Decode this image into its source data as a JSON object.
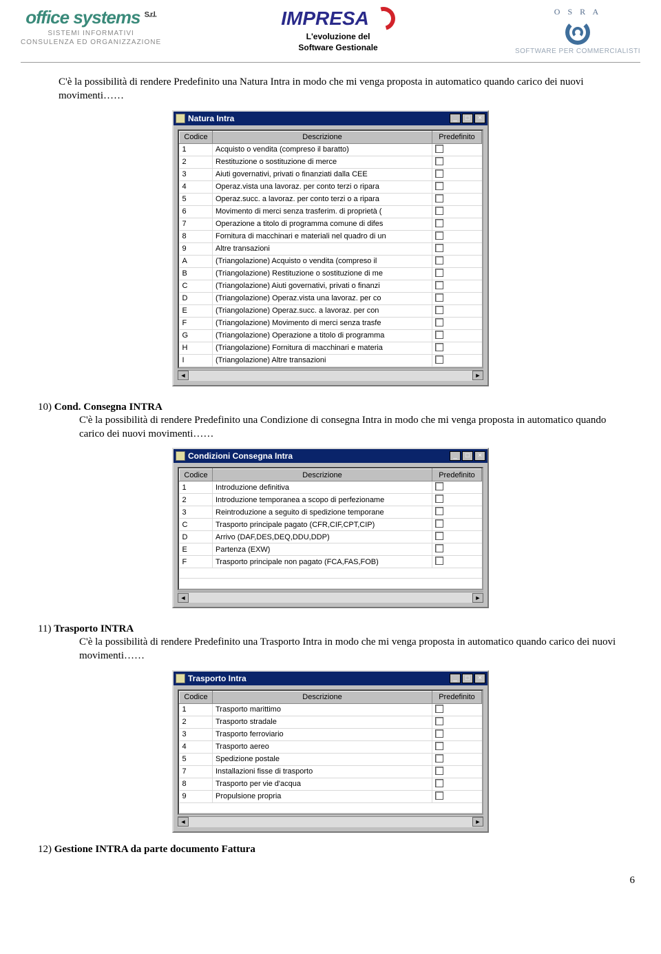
{
  "header": {
    "left": {
      "brand": "office systems",
      "srl": "S.r.l.",
      "sub1": "SISTEMI INFORMATIVI",
      "sub2": "CONSULENZA ED ORGANIZZAZIONE"
    },
    "center": {
      "brand": "IMPRESA",
      "tag_line1": "L'evoluzione del",
      "tag_line2": "Software Gestionale"
    },
    "right": {
      "osra": "O S R A",
      "commerc": "SOFTWARE PER COMMERCIALISTI"
    }
  },
  "intro_para": "C'è  la possibilità di rendere Predefinito una Natura Intra in modo che mi venga proposta in automatico quando carico dei nuovi movimenti……",
  "win1": {
    "title": "Natura Intra",
    "min": "_",
    "max": "□",
    "close": "×",
    "cols": {
      "code": "Codice",
      "desc": "Descrizione",
      "pred": "Predefinito"
    },
    "rows": [
      {
        "c": "1",
        "d": "Acquisto o vendita (compreso il baratto)"
      },
      {
        "c": "2",
        "d": "Restituzione o sostituzione di merce"
      },
      {
        "c": "3",
        "d": "Aiuti governativi, privati o finanziati dalla CEE"
      },
      {
        "c": "4",
        "d": "Operaz.vista una lavoraz. per conto terzi o ripara"
      },
      {
        "c": "5",
        "d": "Operaz.succ. a lavoraz. per conto terzi o a ripara"
      },
      {
        "c": "6",
        "d": "Movimento di merci senza trasferim. di proprietà ("
      },
      {
        "c": "7",
        "d": "Operazione a titolo di programma comune di difes"
      },
      {
        "c": "8",
        "d": "Fornitura di macchinari e materiali nel quadro di un"
      },
      {
        "c": "9",
        "d": "Altre transazioni"
      },
      {
        "c": "A",
        "d": "(Triangolazione) Acquisto o vendita (compreso il"
      },
      {
        "c": "B",
        "d": "(Triangolazione) Restituzione o sostituzione di me"
      },
      {
        "c": "C",
        "d": "(Triangolazione) Aiuti governativi, privati o finanzi"
      },
      {
        "c": "D",
        "d": "(Triangolazione) Operaz.vista una lavoraz. per co"
      },
      {
        "c": "E",
        "d": "(Triangolazione) Operaz.succ. a lavoraz. per con"
      },
      {
        "c": "F",
        "d": "(Triangolazione) Movimento di merci senza trasfe"
      },
      {
        "c": "G",
        "d": "(Triangolazione) Operazione a titolo di programma"
      },
      {
        "c": "H",
        "d": "(Triangolazione) Fornitura di macchinari e materia"
      },
      {
        "c": "I",
        "d": "(Triangolazione) Altre transazioni"
      }
    ],
    "scroll_left": "◄",
    "scroll_right": "►"
  },
  "section10": {
    "num": "10)",
    "title": "Cond. Consegna INTRA",
    "para": "C'è  la possibilità di rendere Predefinito una Condizione di consegna Intra in modo che mi venga proposta in automatico quando carico dei nuovi movimenti……"
  },
  "win2": {
    "title": "Condizioni Consegna Intra",
    "min": "_",
    "max": "□",
    "close": "×",
    "cols": {
      "code": "Codice",
      "desc": "Descrizione",
      "pred": "Predefinito"
    },
    "rows": [
      {
        "c": "1",
        "d": "Introduzione definitiva"
      },
      {
        "c": "2",
        "d": "Introduzione temporanea a scopo di perfezioname"
      },
      {
        "c": "3",
        "d": "Reintroduzione a seguito di spedizione temporane"
      },
      {
        "c": "C",
        "d": "Trasporto principale pagato (CFR,CIF,CPT,CIP)"
      },
      {
        "c": "D",
        "d": "Arrivo (DAF,DES,DEQ,DDU,DDP)"
      },
      {
        "c": "E",
        "d": "Partenza (EXW)"
      },
      {
        "c": "F",
        "d": "Trasporto principale non pagato (FCA,FAS,FOB)"
      }
    ],
    "scroll_left": "◄",
    "scroll_right": "►"
  },
  "section11": {
    "num": "11)",
    "title": "Trasporto INTRA",
    "para": "C'è  la possibilità di rendere Predefinito una Trasporto Intra in modo che mi venga proposta in automatico quando carico dei nuovi movimenti……"
  },
  "win3": {
    "title": "Trasporto Intra",
    "min": "_",
    "max": "□",
    "close": "×",
    "cols": {
      "code": "Codice",
      "desc": "Descrizione",
      "pred": "Predefinito"
    },
    "rows": [
      {
        "c": "1",
        "d": "Trasporto marittimo"
      },
      {
        "c": "2",
        "d": "Trasporto stradale"
      },
      {
        "c": "3",
        "d": "Trasporto ferroviario"
      },
      {
        "c": "4",
        "d": "Trasporto aereo"
      },
      {
        "c": "5",
        "d": "Spedizione postale"
      },
      {
        "c": "7",
        "d": "Installazioni fisse di trasporto"
      },
      {
        "c": "8",
        "d": "Trasporto per vie d'acqua"
      },
      {
        "c": "9",
        "d": "Propulsione propria"
      }
    ],
    "scroll_left": "◄",
    "scroll_right": "►"
  },
  "section12": {
    "num": "12)",
    "title": "Gestione INTRA da parte documento Fattura"
  },
  "page_number": "6"
}
